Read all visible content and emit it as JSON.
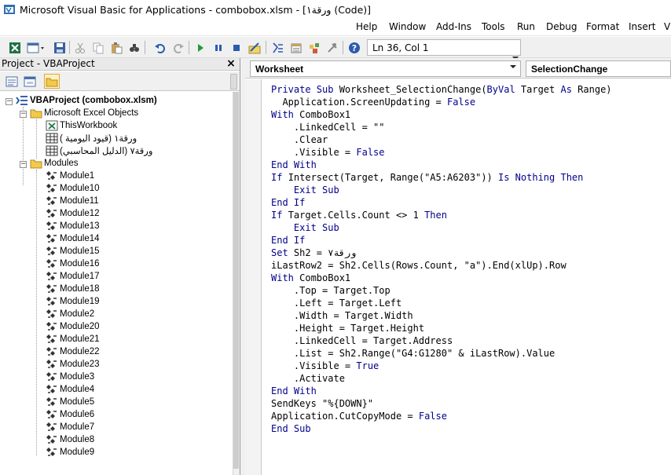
{
  "window": {
    "title": "Microsoft Visual Basic for Applications - combobox.xlsm - [ورقة١ (Code)]",
    "icon": "vba-app-icon"
  },
  "menubar": {
    "items": [
      "Help",
      "Window",
      "Add-Ins",
      "Tools",
      "Run",
      "Debug",
      "Format",
      "Insert",
      "Vi"
    ]
  },
  "toolbar": {
    "status": "Ln 36, Col 1",
    "icons": [
      "excel-view-icon",
      "insert-userform-icon",
      "save-icon",
      "cut-icon",
      "copy-icon",
      "paste-icon",
      "find-icon",
      "undo-icon",
      "redo-icon",
      "run-icon",
      "break-icon",
      "reset-icon",
      "design-mode-icon",
      "project-explorer-icon",
      "properties-icon",
      "object-browser-icon",
      "toolbox-icon",
      "help-icon"
    ]
  },
  "project": {
    "title": "Project - VBAProject",
    "close": "×",
    "root": "VBAProject (combobox.xlsm)",
    "objects_folder": "Microsoft Excel Objects",
    "objects": [
      "ThisWorkbook",
      "ورقة١ (قيود اليومية )",
      "ورقة٧ (الدليل المحاسبي)"
    ],
    "modules_folder": "Modules",
    "modules": [
      "Module1",
      "Module10",
      "Module11",
      "Module12",
      "Module13",
      "Module14",
      "Module15",
      "Module16",
      "Module17",
      "Module18",
      "Module19",
      "Module2",
      "Module20",
      "Module21",
      "Module22",
      "Module23",
      "Module3",
      "Module4",
      "Module5",
      "Module6",
      "Module7",
      "Module8",
      "Module9"
    ]
  },
  "code": {
    "object_combo": "Worksheet",
    "proc_combo": "SelectionChange",
    "lines": [
      [
        [
          "kw",
          "Private Sub "
        ],
        [
          "tx",
          "Worksheet_SelectionChange("
        ],
        [
          "kw",
          "ByVal "
        ],
        [
          "tx",
          "Target "
        ],
        [
          "kw",
          "As "
        ],
        [
          "tx",
          "Range)"
        ]
      ],
      [
        [
          "tx",
          "  Application.ScreenUpdating = "
        ],
        [
          "kw",
          "False"
        ]
      ],
      [
        [
          "kw",
          "With "
        ],
        [
          "tx",
          "ComboBox1"
        ]
      ],
      [
        [
          "tx",
          "    .LinkedCell = \"\""
        ]
      ],
      [
        [
          "tx",
          "    .Clear"
        ]
      ],
      [
        [
          "tx",
          "    .Visible = "
        ],
        [
          "kw",
          "False"
        ]
      ],
      [
        [
          "kw",
          "End With"
        ]
      ],
      [
        [
          "kw",
          "If "
        ],
        [
          "tx",
          "Intersect(Target, Range(\"A5:A6203\")) "
        ],
        [
          "kw",
          "Is Nothing Then"
        ]
      ],
      [
        [
          "kw",
          "    Exit Sub"
        ]
      ],
      [
        [
          "kw",
          "End If"
        ]
      ],
      [
        [
          "kw",
          "If "
        ],
        [
          "tx",
          "Target.Cells.Count <> 1 "
        ],
        [
          "kw",
          "Then"
        ]
      ],
      [
        [
          "kw",
          "    Exit Sub"
        ]
      ],
      [
        [
          "kw",
          "End If"
        ]
      ],
      [
        [
          "kw",
          "Set "
        ],
        [
          "tx",
          "Sh2 = ورقة٧"
        ]
      ],
      [
        [
          "tx",
          "iLastRow2 = Sh2.Cells(Rows.Count, \"a\").End(xlUp).Row"
        ]
      ],
      [
        [
          "kw",
          "With "
        ],
        [
          "tx",
          "ComboBox1"
        ]
      ],
      [
        [
          "tx",
          "    .Top = Target.Top"
        ]
      ],
      [
        [
          "tx",
          "    .Left = Target.Left"
        ]
      ],
      [
        [
          "tx",
          "    .Width = Target.Width"
        ]
      ],
      [
        [
          "tx",
          "    .Height = Target.Height"
        ]
      ],
      [
        [
          "tx",
          "    .LinkedCell = Target.Address"
        ]
      ],
      [
        [
          "tx",
          "    .List = Sh2.Range(\"G4:G1280\" & iLastRow).Value"
        ]
      ],
      [
        [
          "tx",
          "    .Visible = "
        ],
        [
          "kw",
          "True"
        ]
      ],
      [
        [
          "tx",
          "    .Activate"
        ]
      ],
      [
        [
          "kw",
          "End With"
        ]
      ],
      [
        [
          "tx",
          "SendKeys \"%{DOWN}\""
        ]
      ],
      [
        [
          "tx",
          "Application.CutCopyMode = "
        ],
        [
          "kw",
          "False"
        ]
      ],
      [
        [
          "kw",
          "End Sub"
        ]
      ]
    ]
  },
  "colors": {
    "keyword": "#00008b",
    "text": "#000000",
    "toolbar_bg": "#f0f0f0"
  }
}
